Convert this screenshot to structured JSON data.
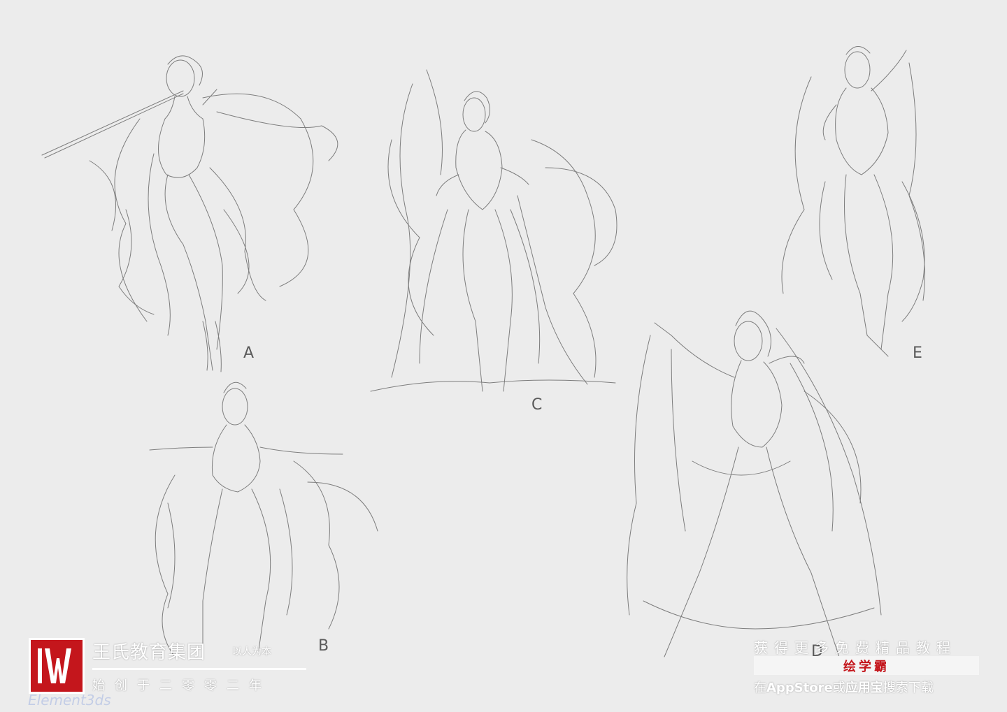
{
  "figures": [
    {
      "label": "A"
    },
    {
      "label": "B"
    },
    {
      "label": "C"
    },
    {
      "label": "D"
    },
    {
      "label": "E"
    }
  ],
  "watermark_left": {
    "company": "王氏教育集团",
    "tag": "以人为本",
    "since": "始创于二零零二年",
    "faint_text": "Element3ds"
  },
  "watermark_right": {
    "line1": "获得更多免费精品教程",
    "app_name": "绘学霸",
    "line3_prefix": "在",
    "store1": "AppStore",
    "line3_mid": "或",
    "store2": "应用宝",
    "line3_suffix": "搜索下载"
  },
  "colors": {
    "paper": "#ececec",
    "pencil": "#6a6a6a",
    "brand_red": "#c4161c"
  }
}
